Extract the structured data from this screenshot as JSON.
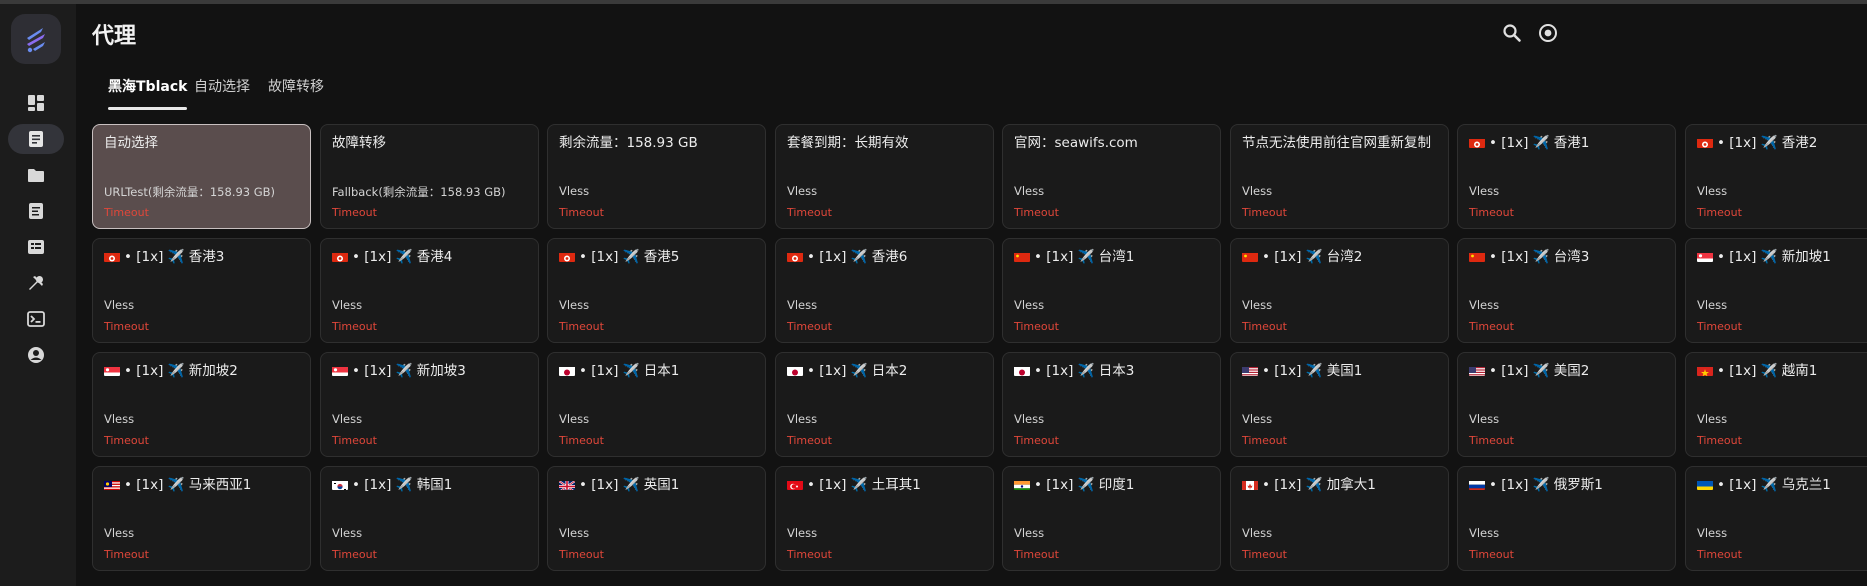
{
  "app": {
    "title": "代理",
    "accent": "#7c6cf0"
  },
  "sidebar": {
    "items": [
      {
        "icon": "dashboard-icon",
        "active": false
      },
      {
        "icon": "proxies-icon",
        "active": true
      },
      {
        "icon": "folder-icon",
        "active": false
      },
      {
        "icon": "rules-icon",
        "active": false
      },
      {
        "icon": "connections-icon",
        "active": false
      },
      {
        "icon": "tools-icon",
        "active": false
      },
      {
        "icon": "logs-icon",
        "active": false
      },
      {
        "icon": "profile-icon",
        "active": false
      }
    ]
  },
  "header": {
    "actions": [
      {
        "icon": "search-icon"
      },
      {
        "icon": "target-icon"
      }
    ]
  },
  "tabs": [
    {
      "label": "黑海Tblack",
      "active": true
    },
    {
      "label": "自动选择",
      "active": false
    },
    {
      "label": "故障转移",
      "active": false
    }
  ],
  "proxies": [
    {
      "name": "自动选择",
      "type": "URLTest(剩余流量：158.93 GB)",
      "delay": "Timeout",
      "flag": "",
      "selected": true
    },
    {
      "name": "故障转移",
      "type": "Fallback(剩余流量：158.93 GB)",
      "delay": "Timeout",
      "flag": ""
    },
    {
      "name": "剩余流量：158.93 GB",
      "type": "Vless",
      "delay": "Timeout",
      "flag": ""
    },
    {
      "name": "套餐到期：长期有效",
      "type": "Vless",
      "delay": "Timeout",
      "flag": ""
    },
    {
      "name": "官网：seawifs.com",
      "type": "Vless",
      "delay": "Timeout",
      "flag": ""
    },
    {
      "name": "节点无法使用前往官网重新复制",
      "type": "Vless",
      "delay": "Timeout",
      "flag": ""
    },
    {
      "name": "• [1x] ✈️ 香港1",
      "type": "Vless",
      "delay": "Timeout",
      "flag": "hk"
    },
    {
      "name": "• [1x] ✈️ 香港2",
      "type": "Vless",
      "delay": "Timeout",
      "flag": "hk"
    },
    {
      "name": "• [1x] ✈️ 香港3",
      "type": "Vless",
      "delay": "Timeout",
      "flag": "hk"
    },
    {
      "name": "• [1x] ✈️ 香港4",
      "type": "Vless",
      "delay": "Timeout",
      "flag": "hk"
    },
    {
      "name": "• [1x] ✈️ 香港5",
      "type": "Vless",
      "delay": "Timeout",
      "flag": "hk"
    },
    {
      "name": "• [1x] ✈️ 香港6",
      "type": "Vless",
      "delay": "Timeout",
      "flag": "hk"
    },
    {
      "name": "• [1x] ✈️ 台湾1",
      "type": "Vless",
      "delay": "Timeout",
      "flag": "cn"
    },
    {
      "name": "• [1x] ✈️ 台湾2",
      "type": "Vless",
      "delay": "Timeout",
      "flag": "cn"
    },
    {
      "name": "• [1x] ✈️ 台湾3",
      "type": "Vless",
      "delay": "Timeout",
      "flag": "cn"
    },
    {
      "name": "• [1x] ✈️ 新加坡1",
      "type": "Vless",
      "delay": "Timeout",
      "flag": "sg"
    },
    {
      "name": "• [1x] ✈️ 新加坡2",
      "type": "Vless",
      "delay": "Timeout",
      "flag": "sg"
    },
    {
      "name": "• [1x] ✈️ 新加坡3",
      "type": "Vless",
      "delay": "Timeout",
      "flag": "sg"
    },
    {
      "name": "• [1x] ✈️ 日本1",
      "type": "Vless",
      "delay": "Timeout",
      "flag": "jp"
    },
    {
      "name": "• [1x] ✈️ 日本2",
      "type": "Vless",
      "delay": "Timeout",
      "flag": "jp"
    },
    {
      "name": "• [1x] ✈️ 日本3",
      "type": "Vless",
      "delay": "Timeout",
      "flag": "jp"
    },
    {
      "name": "• [1x] ✈️ 美国1",
      "type": "Vless",
      "delay": "Timeout",
      "flag": "us"
    },
    {
      "name": "• [1x] ✈️ 美国2",
      "type": "Vless",
      "delay": "Timeout",
      "flag": "us"
    },
    {
      "name": "• [1x] ✈️ 越南1",
      "type": "Vless",
      "delay": "Timeout",
      "flag": "vn"
    },
    {
      "name": "• [1x] ✈️ 马来西亚1",
      "type": "Vless",
      "delay": "Timeout",
      "flag": "my"
    },
    {
      "name": "• [1x] ✈️ 韩国1",
      "type": "Vless",
      "delay": "Timeout",
      "flag": "kr"
    },
    {
      "name": "• [1x] ✈️ 英国1",
      "type": "Vless",
      "delay": "Timeout",
      "flag": "gb"
    },
    {
      "name": "• [1x] ✈️ 土耳其1",
      "type": "Vless",
      "delay": "Timeout",
      "flag": "tr"
    },
    {
      "name": "• [1x] ✈️ 印度1",
      "type": "Vless",
      "delay": "Timeout",
      "flag": "in"
    },
    {
      "name": "• [1x] ✈️ 加拿大1",
      "type": "Vless",
      "delay": "Timeout",
      "flag": "ca"
    },
    {
      "name": "• [1x] ✈️ 俄罗斯1",
      "type": "Vless",
      "delay": "Timeout",
      "flag": "ru"
    },
    {
      "name": "• [1x] ✈️ 乌克兰1",
      "type": "Vless",
      "delay": "Timeout",
      "flag": "ua"
    }
  ],
  "colors": {
    "background": "#121212",
    "sidebar": "#1c1c1c",
    "card": "#1a1a1a",
    "card_selected": "#5a4d4d",
    "timeout": "#e0473a"
  }
}
